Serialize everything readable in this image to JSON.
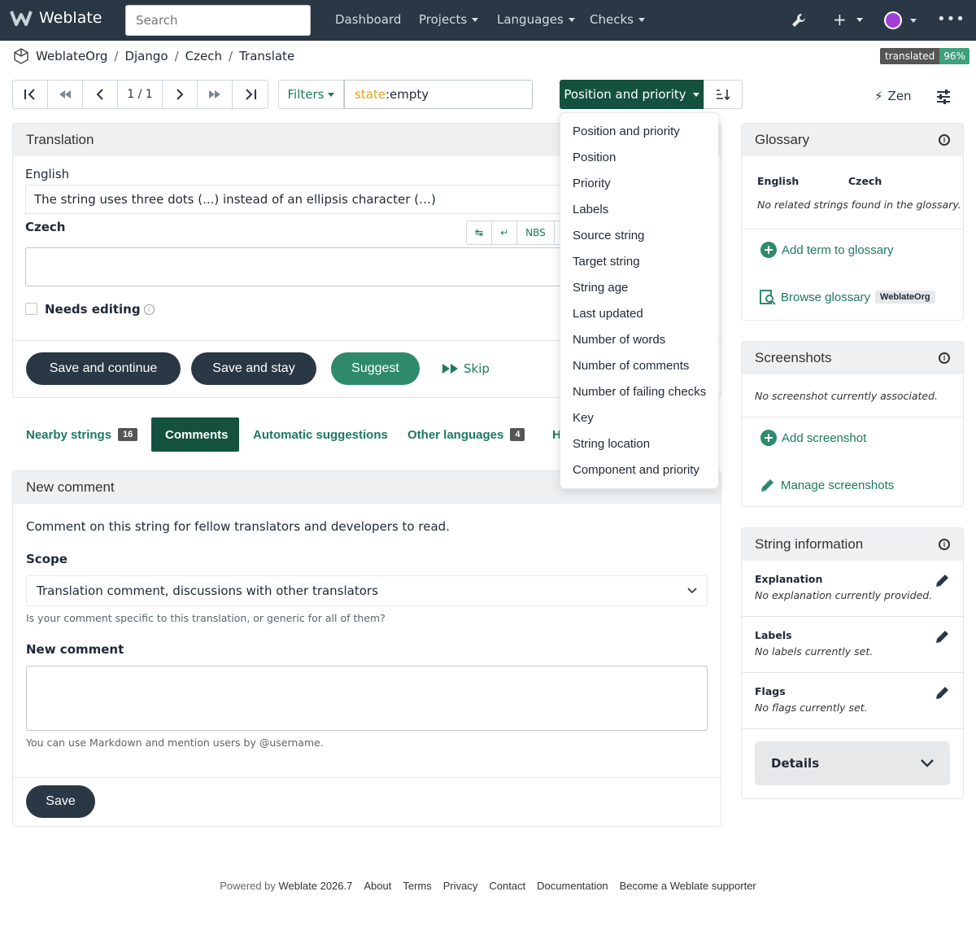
{
  "navbar": {
    "brand": "Weblate",
    "search_placeholder": "Search",
    "links": [
      "Dashboard",
      "Projects",
      "Languages",
      "Checks"
    ]
  },
  "breadcrumb": [
    "WeblateOrg",
    "Django",
    "Czech",
    "Translate"
  ],
  "translated_badge": {
    "label": "translated",
    "value": "96%"
  },
  "pager": {
    "position": "1 / 1"
  },
  "filters": {
    "label": "Filters",
    "query_key": "state",
    "query_value": ":empty"
  },
  "sort": {
    "label": "Position and priority"
  },
  "zen_label": "Zen",
  "translation": {
    "title": "Translation",
    "source_lang": "English",
    "source_text": "The string uses three dots (...) instead of an ellipsis character (…)",
    "target_lang": "Czech",
    "toolbar": [
      "↹",
      "↵",
      "NBS",
      "…"
    ],
    "needs_editing": "Needs editing",
    "buttons": {
      "save_continue": "Save and continue",
      "save_stay": "Save and stay",
      "suggest": "Suggest",
      "skip": "Skip"
    }
  },
  "tabs": [
    {
      "label": "Nearby strings",
      "count": "16"
    },
    {
      "label": "Comments",
      "count": ""
    },
    {
      "label": "Automatic suggestions",
      "count": ""
    },
    {
      "label": "Other languages",
      "count": "4"
    },
    {
      "label": "H",
      "count": ""
    }
  ],
  "sort_menu": [
    "Position and priority",
    "Position",
    "Priority",
    "Labels",
    "Source string",
    "Target string",
    "String age",
    "Last updated",
    "Number of words",
    "Number of comments",
    "Number of failing checks",
    "Key",
    "String location",
    "Component and priority"
  ],
  "comment": {
    "title": "New comment",
    "intro": "Comment on this string for fellow translators and developers to read.",
    "scope_label": "Scope",
    "scope_value": "Translation comment, discussions with other translators",
    "scope_help": "Is your comment specific to this translation, or generic for all of them?",
    "new_comment_label": "New comment",
    "markdown_help": "You can use Markdown and mention users by @username.",
    "save": "Save"
  },
  "glossary": {
    "title": "Glossary",
    "col1": "English",
    "col2": "Czech",
    "empty": "No related strings found in the glossary.",
    "add": "Add term to glossary",
    "browse": "Browse glossary",
    "tag": "WeblateOrg"
  },
  "screenshots": {
    "title": "Screenshots",
    "empty": "No screenshot currently associated.",
    "add": "Add screenshot",
    "manage": "Manage screenshots"
  },
  "string_info": {
    "title": "String information",
    "explanation_label": "Explanation",
    "explanation_value": "No explanation currently provided.",
    "labels_label": "Labels",
    "labels_value": "No labels currently set.",
    "flags_label": "Flags",
    "flags_value": "No flags currently set.",
    "details": "Details"
  },
  "footer": {
    "powered": "Powered by",
    "version": "Weblate 2026.7",
    "links": [
      "About",
      "Terms",
      "Privacy",
      "Contact",
      "Documentation",
      "Become a Weblate supporter"
    ]
  },
  "colors": {
    "navbar": "#2a3744",
    "accent": "#1d7a5f",
    "primary_dark": "#14523f"
  }
}
